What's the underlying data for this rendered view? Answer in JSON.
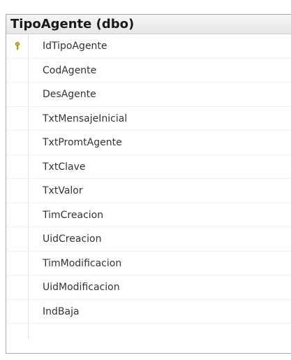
{
  "table": {
    "title": "TipoAgente (dbo)",
    "key_icon": "primary-key-icon",
    "key_color": "#c9b735",
    "columns": [
      {
        "name": "IdTipoAgente",
        "primary_key": true
      },
      {
        "name": "CodAgente",
        "primary_key": false
      },
      {
        "name": "DesAgente",
        "primary_key": false
      },
      {
        "name": "TxtMensajeInicial",
        "primary_key": false
      },
      {
        "name": "TxtPromtAgente",
        "primary_key": false
      },
      {
        "name": "TxtClave",
        "primary_key": false
      },
      {
        "name": "TxtValor",
        "primary_key": false
      },
      {
        "name": "TimCreacion",
        "primary_key": false
      },
      {
        "name": "UidCreacion",
        "primary_key": false
      },
      {
        "name": "TimModificacion",
        "primary_key": false
      },
      {
        "name": "UidModificacion",
        "primary_key": false
      },
      {
        "name": "IndBaja",
        "primary_key": false
      }
    ]
  }
}
